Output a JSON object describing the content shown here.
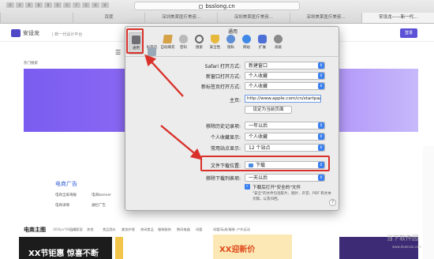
{
  "browser": {
    "url": "bsslong.cn",
    "bookmarks": [
      "O",
      "A",
      "B",
      "B",
      "B",
      "D",
      "G",
      "F",
      "G",
      "H",
      "H"
    ],
    "tabs": [
      {
        "label": "",
        "active": false
      },
      {
        "label": "百度",
        "active": false
      },
      {
        "label": "深圳美莱医疗美容...",
        "active": false
      },
      {
        "label": "深圳美莱医疗美容...",
        "active": false
      },
      {
        "label": "深圳美莱医疗美容...",
        "active": false
      },
      {
        "label": "安设龙——新一代...",
        "active": true
      }
    ]
  },
  "site": {
    "logo_text": "安设龙",
    "slogan": "| 新一代设计平台",
    "login": "登录",
    "nav_hint": "热门搜索  ",
    "section_title": "电商广告",
    "links": [
      "电商全屏海报",
      "电商banner",
      "电商详情",
      "通栏广告"
    ],
    "banner_title": "电商主图",
    "banner_sub": "(800px*800px)",
    "categories": [
      "日用家居",
      "其他",
      "食品酒水",
      "美妆护理",
      "休闲食品",
      "服装服饰",
      "数码电器",
      "母婴",
      "母婴/玩具/服装",
      "户外运动"
    ],
    "tile_texts": [
      "XX节钜惠 惊喜不断",
      "XX迎新价"
    ],
    "watermark": "当下软件园",
    "watermark_sub": "www.downxia.com"
  },
  "dialog": {
    "title": "通用",
    "toolbar": [
      {
        "label": "通用",
        "icon": "general-icon",
        "active": true
      },
      {
        "label": "标签页",
        "icon": "tabs-icon",
        "active": false
      },
      {
        "label": "自动填充",
        "icon": "autofill-icon",
        "active": false
      },
      {
        "label": "密码",
        "icon": "key-icon",
        "active": false
      },
      {
        "label": "搜索",
        "icon": "search-icon",
        "active": false
      },
      {
        "label": "安全性",
        "icon": "security-icon",
        "active": false
      },
      {
        "label": "隐私",
        "icon": "privacy-icon",
        "active": false
      },
      {
        "label": "网站",
        "icon": "globe-icon",
        "active": false
      },
      {
        "label": "扩展",
        "icon": "extensions-icon",
        "active": false
      },
      {
        "label": "高级",
        "icon": "gear-icon",
        "active": false
      }
    ],
    "safari_open_label": "Safari 打开方式:",
    "safari_open_value": "新建窗口",
    "new_window_label": "新窗口打开方式:",
    "new_window_value": "个人收藏",
    "new_tab_label": "新标签页打开方式:",
    "new_tab_value": "个人收藏",
    "homepage_label": "主页:",
    "homepage_value": "http://www.apple.com/cn/startpage/",
    "set_current_label": "设定为当前页面",
    "history_label": "移除历史记录项:",
    "history_value": "一年以后",
    "favorites_label": "个人收藏显示:",
    "favorites_value": "个人收藏",
    "top_sites_label": "常用站点显示:",
    "top_sites_value": "12 个站点",
    "download_loc_label": "文件下载位置:",
    "download_loc_value": "下载",
    "remove_dl_label": "移除下载列表项:",
    "remove_dl_value": "一天以后",
    "open_safe_label": "下载后打开\"安全的\"文件",
    "open_safe_note": "\"安全\"的文件包括影片、图片、声音、PDF 和文本文稿，以及归档。",
    "help": "?",
    "accent": "#3a7ff0"
  },
  "annotation": {
    "color": "#d9312a"
  }
}
